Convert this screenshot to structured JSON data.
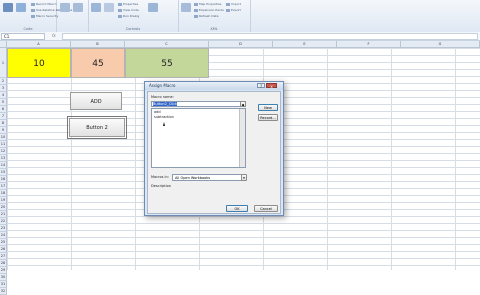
{
  "ribbon": {
    "groups": [
      {
        "label": "Code"
      },
      {
        "label": "Controls"
      },
      {
        "label": "XML"
      }
    ],
    "code_items": [
      "Record Macro",
      "Use Relative References",
      "Macro Security"
    ],
    "controls_items": [
      "Properties",
      "View Code",
      "Run Dialog"
    ],
    "xml_items": [
      "Map Properties",
      "Expansion Packs",
      "Refresh Data"
    ],
    "xml_items2": [
      "Import",
      "Export"
    ]
  },
  "formula_bar": {
    "name_box": "C1",
    "fx": "fx",
    "value": ""
  },
  "columns": [
    "A",
    "B",
    "C",
    "D",
    "E",
    "F",
    "G"
  ],
  "rows": [
    "1",
    "2",
    "3",
    "4",
    "5",
    "6",
    "7",
    "8",
    "9",
    "10",
    "11",
    "12",
    "13",
    "14",
    "15",
    "16",
    "17",
    "18",
    "19",
    "20",
    "21",
    "22",
    "23",
    "24",
    "25",
    "26",
    "27",
    "28",
    "29",
    "30",
    "31",
    "32"
  ],
  "cells": {
    "a1": {
      "value": "10",
      "color": "#ffff00"
    },
    "b1": {
      "value": "45",
      "color": "#f8cbad"
    },
    "c1": {
      "value": "55",
      "color": "#c4d79b"
    }
  },
  "sheet_buttons": [
    {
      "label": "ADD"
    },
    {
      "label": "Button 2"
    }
  ],
  "dialog": {
    "title": "Assign Macro",
    "macro_name_label": "Macro name:",
    "macro_name_value": "Button2_Click",
    "macros": [
      "add",
      "subtraction"
    ],
    "new_button": "New",
    "record_button": "Record...",
    "macros_in_label": "Macros in:",
    "macros_in_value": "All Open Workbooks",
    "description_label": "Description",
    "ok_button": "OK",
    "cancel_button": "Cancel",
    "help_button": "?",
    "close_button": "x"
  }
}
